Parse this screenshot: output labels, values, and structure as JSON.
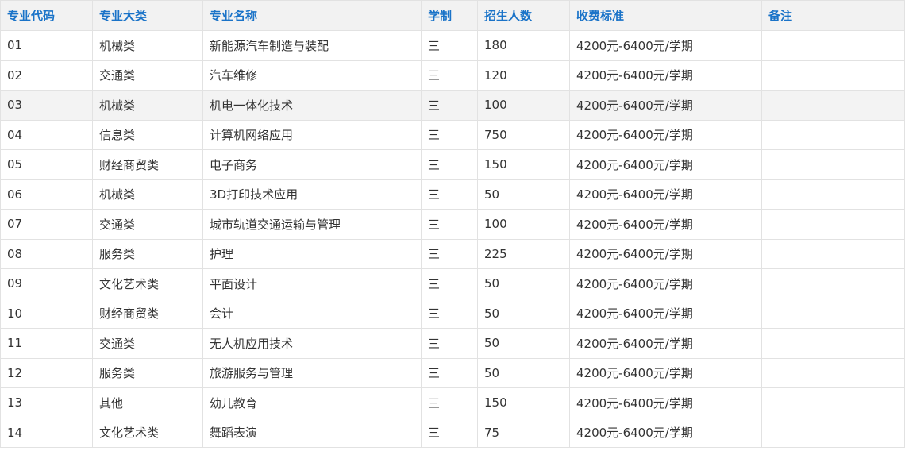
{
  "headers": [
    "专业代码",
    "专业大类",
    "专业名称",
    "学制",
    "招生人数",
    "收费标准",
    "备注"
  ],
  "rows": [
    [
      "01",
      "机械类",
      "新能源汽车制造与装配",
      "三",
      "180",
      "4200元-6400元/学期",
      ""
    ],
    [
      "02",
      "交通类",
      "汽车维修",
      "三",
      "120",
      "4200元-6400元/学期",
      ""
    ],
    [
      "03",
      "机械类",
      "机电一体化技术",
      "三",
      "100",
      "4200元-6400元/学期",
      ""
    ],
    [
      "04",
      "信息类",
      "计算机网络应用",
      "三",
      "750",
      "4200元-6400元/学期",
      ""
    ],
    [
      "05",
      "财经商贸类",
      "电子商务",
      "三",
      "150",
      "4200元-6400元/学期",
      ""
    ],
    [
      "06",
      "机械类",
      "3D打印技术应用",
      "三",
      "50",
      "4200元-6400元/学期",
      ""
    ],
    [
      "07",
      "交通类",
      "城市轨道交通运输与管理",
      "三",
      "100",
      "4200元-6400元/学期",
      ""
    ],
    [
      "08",
      "服务类",
      "护理",
      "三",
      "225",
      "4200元-6400元/学期",
      ""
    ],
    [
      "09",
      "文化艺术类",
      "平面设计",
      "三",
      "50",
      "4200元-6400元/学期",
      ""
    ],
    [
      "10",
      "财经商贸类",
      "会计",
      "三",
      "50",
      "4200元-6400元/学期",
      ""
    ],
    [
      "11",
      "交通类",
      "无人机应用技术",
      "三",
      "50",
      "4200元-6400元/学期",
      ""
    ],
    [
      "12",
      "服务类",
      "旅游服务与管理",
      "三",
      "50",
      "4200元-6400元/学期",
      ""
    ],
    [
      "13",
      "其他",
      "幼儿教育",
      "三",
      "150",
      "4200元-6400元/学期",
      ""
    ],
    [
      "14",
      "文化艺术类",
      "舞蹈表演",
      "三",
      "75",
      "4200元-6400元/学期",
      ""
    ]
  ],
  "highlighted_row": 2,
  "colors": {
    "header_text": "#1a73c8",
    "header_bg": "#f2f2f2",
    "highlight_bg": "#f3f3f3",
    "border": "#e2e2e2",
    "body_text": "#333333"
  }
}
